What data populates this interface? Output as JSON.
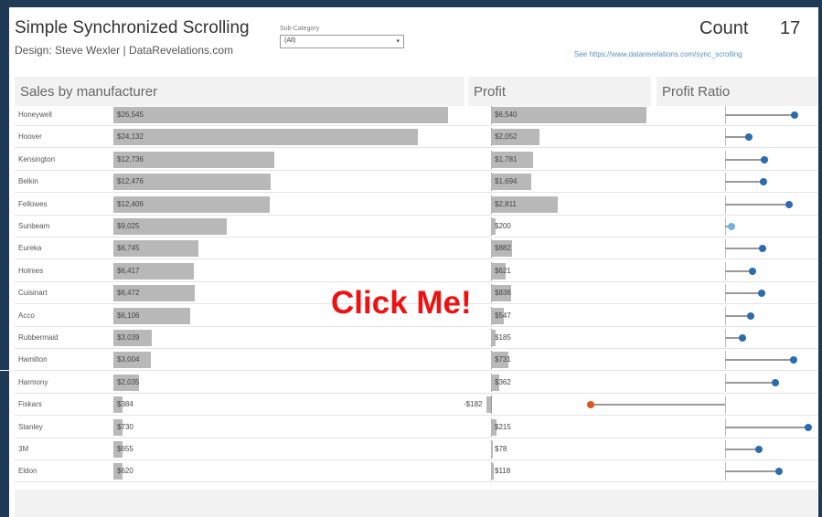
{
  "header": {
    "title": "Simple Synchronized Scrolling",
    "subtitle": "Design: Steve Wexler | DataRevelations.com",
    "filter_label": "Sub-Category",
    "filter_value": "(All)",
    "count_label": "Count",
    "count_value": "17",
    "source": "See https://www.datarevelations.com/sync_scrolling"
  },
  "panels": {
    "sales": "Sales by manufacturer",
    "profit": "Profit",
    "ratio": "Profit Ratio"
  },
  "overlay": {
    "click_label": "Click Me!"
  },
  "colors": {
    "positive": "#2b6cb0",
    "light_positive": "#6fb2e6",
    "negative": "#e0561c"
  },
  "rows": [
    {
      "manufacturer": "Honeywell",
      "sales_label": "$26,545",
      "sales": 26545,
      "profit_label": "$6,540",
      "profit": 6540,
      "ratio": 0.246
    },
    {
      "manufacturer": "Hoover",
      "sales_label": "$24,132",
      "sales": 24132,
      "profit_label": "$2,052",
      "profit": 2052,
      "ratio": 0.085
    },
    {
      "manufacturer": "Kensington",
      "sales_label": "$12,736",
      "sales": 12736,
      "profit_label": "$1,781",
      "profit": 1781,
      "ratio": 0.14
    },
    {
      "manufacturer": "Belkin",
      "sales_label": "$12,476",
      "sales": 12476,
      "profit_label": "$1,694",
      "profit": 1694,
      "ratio": 0.136
    },
    {
      "manufacturer": "Fellowes",
      "sales_label": "$12,406",
      "sales": 12406,
      "profit_label": "$2,811",
      "profit": 2811,
      "ratio": 0.227
    },
    {
      "manufacturer": "Sunbeam",
      "sales_label": "$9,025",
      "sales": 9025,
      "profit_label": "$200",
      "profit": 200,
      "ratio": 0.022
    },
    {
      "manufacturer": "Eureka",
      "sales_label": "$6,745",
      "sales": 6745,
      "profit_label": "$882",
      "profit": 882,
      "ratio": 0.131
    },
    {
      "manufacturer": "Holmes",
      "sales_label": "$6,417",
      "sales": 6417,
      "profit_label": "$621",
      "profit": 621,
      "ratio": 0.097
    },
    {
      "manufacturer": "Cuisinart",
      "sales_label": "$6,472",
      "sales": 6472,
      "profit_label": "$836",
      "profit": 836,
      "ratio": 0.129
    },
    {
      "manufacturer": "Acco",
      "sales_label": "$6,106",
      "sales": 6106,
      "profit_label": "$547",
      "profit": 547,
      "ratio": 0.09
    },
    {
      "manufacturer": "Rubbermaid",
      "sales_label": "$3,039",
      "sales": 3039,
      "profit_label": "$185",
      "profit": 185,
      "ratio": 0.061
    },
    {
      "manufacturer": "Hamilton",
      "sales_label": "$3,004",
      "sales": 3004,
      "profit_label": "$731",
      "profit": 731,
      "ratio": 0.243
    },
    {
      "manufacturer": "Harmony",
      "sales_label": "$2,035",
      "sales": 2035,
      "profit_label": "$362",
      "profit": 362,
      "ratio": 0.178
    },
    {
      "manufacturer": "Fiskars",
      "sales_label": "$384",
      "sales": 384,
      "profit_label": "-$182",
      "profit": -182,
      "ratio": -0.474
    },
    {
      "manufacturer": "Stanley",
      "sales_label": "$730",
      "sales": 730,
      "profit_label": "$215",
      "profit": 215,
      "ratio": 0.295
    },
    {
      "manufacturer": "3M",
      "sales_label": "$655",
      "sales": 655,
      "profit_label": "$78",
      "profit": 78,
      "ratio": 0.119
    },
    {
      "manufacturer": "Eldon",
      "sales_label": "$620",
      "sales": 620,
      "profit_label": "$118",
      "profit": 118,
      "ratio": 0.19
    }
  ]
}
